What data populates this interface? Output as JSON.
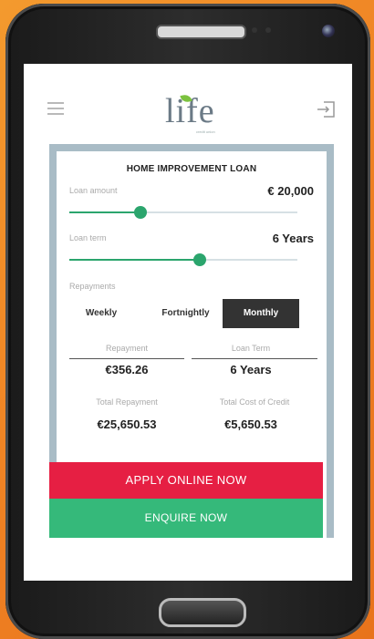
{
  "header": {
    "logo_text": "life",
    "logo_tagline": "credit union"
  },
  "loan": {
    "title": "HOME IMPROVEMENT LOAN",
    "amount_label": "Loan amount",
    "amount_value": "€ 20,000",
    "amount_slider_level": 0.31,
    "term_label": "Loan term",
    "term_value": "6 Years",
    "term_slider_level": 0.57,
    "repayments_label": "Repayments",
    "frequency_options": [
      "Weekly",
      "Fortnightly",
      "Monthly"
    ],
    "frequency_selected": "Monthly"
  },
  "results": {
    "repayment_label": "Repayment",
    "repayment_value": "€356.26",
    "term_label": "Loan Term",
    "term_value": "6 Years",
    "total_repayment_label": "Total Repayment",
    "total_repayment_value": "€25,650.53",
    "total_cost_label": "Total Cost of Credit",
    "total_cost_value": "€5,650.53"
  },
  "actions": {
    "apply_label": "APPLY ONLINE NOW",
    "enquire_label": "ENQUIRE NOW"
  },
  "colors": {
    "background": "#ee7f22",
    "accent_green": "#2ba56d",
    "apply_red": "#e61f43",
    "enquire_green": "#35b97a",
    "panel": "#a9bcc6"
  }
}
